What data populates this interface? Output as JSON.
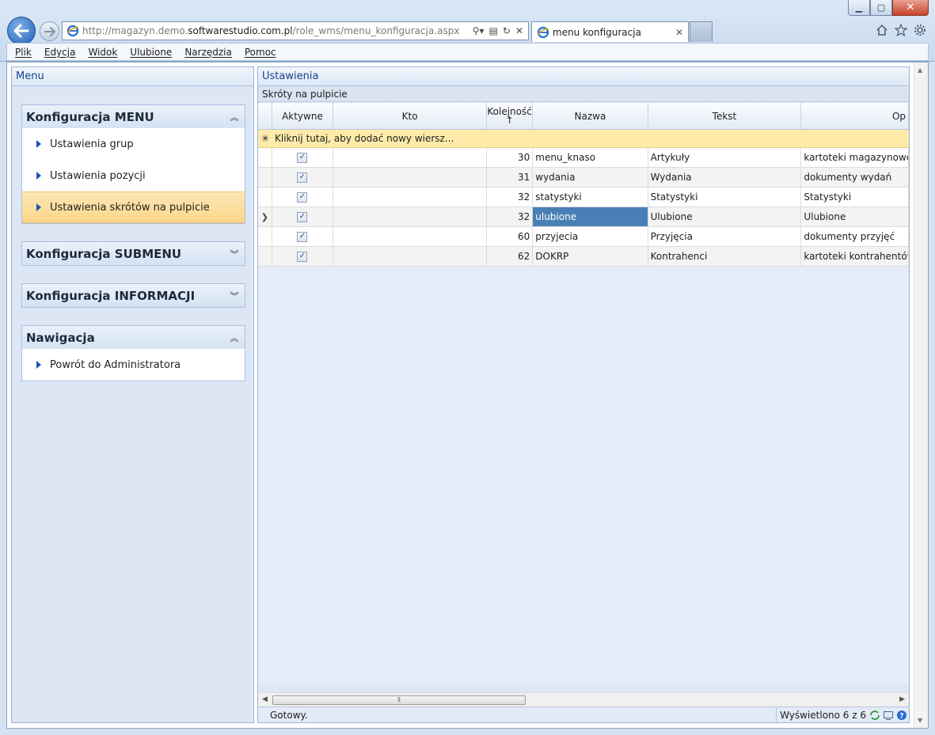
{
  "browser": {
    "url_prefix": "http://magazyn.demo.",
    "url_host": "softwarestudio.com.pl",
    "url_path": "/role_wms/menu_konfiguracja.aspx",
    "tab_title": "menu konfiguracja",
    "menu": [
      "Plik",
      "Edycja",
      "Widok",
      "Ulubione",
      "Narzędzia",
      "Pomoc"
    ]
  },
  "left_panel": {
    "title": "Menu",
    "groups": [
      {
        "title": "Konfiguracja MENU",
        "expanded": true,
        "items": [
          "Ustawienia grup",
          "Ustawienia pozycji",
          "Ustawienia skrótów na pulpicie"
        ],
        "selected_item": "Ustawienia skrótów na pulpicie"
      },
      {
        "title": "Konfiguracja SUBMENU",
        "expanded": false,
        "items": []
      },
      {
        "title": "Konfiguracja INFORMACJI",
        "expanded": false,
        "items": []
      },
      {
        "title": "Nawigacja",
        "expanded": true,
        "items": [
          "Powrót do Administratora"
        ]
      }
    ]
  },
  "right_panel": {
    "title": "Ustawienia",
    "grid_caption": "Skróty na pulpicie",
    "columns": [
      "Aktywne",
      "Kto",
      "Kolejność",
      "Nazwa",
      "Tekst",
      "Op"
    ],
    "sort_indicator": "↑",
    "new_row_text": "Kliknij tutaj, aby dodać nowy wiersz...",
    "rows": [
      {
        "aktywne": true,
        "kto": "",
        "kolejnosc": "30",
        "nazwa": "menu_knaso",
        "tekst": "Artykuły",
        "opis": "kartoteki magazynowe"
      },
      {
        "aktywne": true,
        "kto": "",
        "kolejnosc": "31",
        "nazwa": "wydania",
        "tekst": "Wydania",
        "opis": "dokumenty wydań"
      },
      {
        "aktywne": true,
        "kto": "",
        "kolejnosc": "32",
        "nazwa": "statystyki",
        "tekst": "Statystyki",
        "opis": "Statystyki"
      },
      {
        "aktywne": true,
        "kto": "",
        "kolejnosc": "32",
        "nazwa": "ulubione",
        "tekst": "Ulubione",
        "opis": "Ulubione",
        "current": true
      },
      {
        "aktywne": true,
        "kto": "",
        "kolejnosc": "60",
        "nazwa": "przyjecia",
        "tekst": "Przyjęcia",
        "opis": "dokumenty przyjęć"
      },
      {
        "aktywne": true,
        "kto": "",
        "kolejnosc": "62",
        "nazwa": "DOKRP",
        "tekst": "Kontrahenci",
        "opis": "kartoteki kontrahentów"
      }
    ],
    "status_text": "Gotowy.",
    "record_count": "Wyświetlono 6 z 6"
  },
  "colors": {
    "selected_cell": "#4a7fb5",
    "selected_nav": "#fbd68a",
    "panel_header_text": "#15428b"
  }
}
